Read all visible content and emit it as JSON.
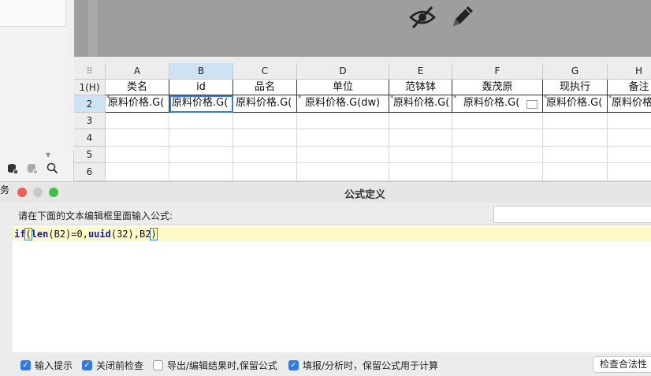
{
  "left_panel": {
    "toolbar_icons": [
      "database-settings-icon",
      "database-icon",
      "search-icon"
    ],
    "truncated_label": "务"
  },
  "canvas": {
    "icons": [
      "eye-slash-icon",
      "pencil-icon"
    ]
  },
  "grid": {
    "corner": "⠿",
    "columns": [
      "A",
      "B",
      "C",
      "D",
      "E",
      "F",
      "G",
      "H"
    ],
    "selected_column": "B",
    "rows": [
      "1(H)",
      "2",
      "3",
      "4",
      "5",
      "6"
    ],
    "selected_row": "2",
    "header_row": [
      "类名",
      "id",
      "品名",
      "单位",
      "范钵钵",
      "轰茂原",
      "现执行",
      "备注"
    ],
    "data_row": [
      "原料价格.G(",
      "原料价格.G(",
      "原料价格.G(",
      "原料价格.G(dw)",
      "原料价格.G(",
      "原料价格.G(",
      "原料价格.G(",
      "原料价格.G"
    ]
  },
  "dialog": {
    "title": "公式定义",
    "prompt": "请在下面的文本编辑框里面输入公式:",
    "formula": {
      "tokens": [
        {
          "text": "if",
          "type": "kw"
        },
        {
          "text": "(",
          "type": "paren"
        },
        {
          "text": "len",
          "type": "fn"
        },
        {
          "text": "(B2)=0,",
          "type": "plain"
        },
        {
          "text": "uuid",
          "type": "fn"
        },
        {
          "text": "(32),B2",
          "type": "plain"
        },
        {
          "text": ")",
          "type": "paren"
        }
      ]
    },
    "checkboxes": [
      {
        "label": "输入提示",
        "checked": true
      },
      {
        "label": "关闭前检查",
        "checked": true
      },
      {
        "label": "导出/编辑结果时,保留公式",
        "checked": false
      },
      {
        "label": "填报/分析时，保留公式用于计算",
        "checked": true
      }
    ],
    "check_button": "检查合法性",
    "colors": {
      "accent": "#2f7ae5",
      "close": "#ec5f57",
      "minimize": "#c9c9c9",
      "maximize": "#3fc04b",
      "formula_bg": "#fdfac7"
    }
  }
}
